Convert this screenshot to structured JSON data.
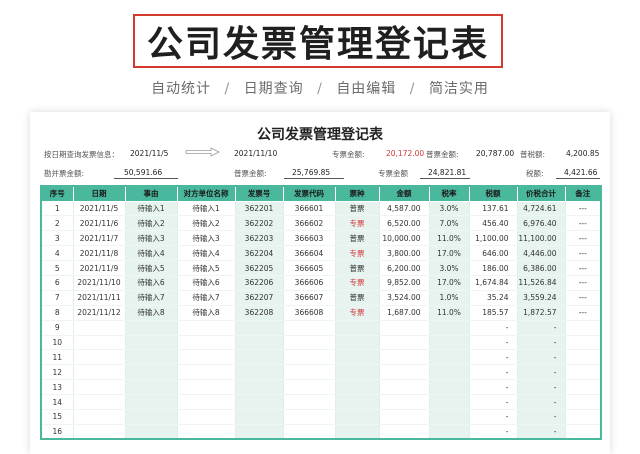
{
  "header": {
    "title": "公司发票管理登记表",
    "subtitle": [
      "自动统计",
      "日期查询",
      "自由编辑",
      "简洁实用"
    ],
    "separator": "/"
  },
  "sheet": {
    "title": "公司发票管理登记表",
    "query_label": "按日期查询发票信息：",
    "date_from": "2021/11/5",
    "date_to": "2021/11/10",
    "special_label": "专票金额:",
    "special_value": "20,172.00",
    "normal_label": "普票金额:",
    "normal_value": "20,787.00",
    "tax_label": "普税额:",
    "tax_value": "4,200.85",
    "cert_label": "勘并票金额:",
    "cert_value": "50,591.66",
    "normal2_label": "普票金额:",
    "normal2_value": "25,769.85",
    "special2_label": "专票金额",
    "special2_value": "24,821.81",
    "tax2_label": "税额:",
    "tax2_value": "4,421.66"
  },
  "table": {
    "headers": [
      "序号",
      "日期",
      "事由",
      "对方单位名称",
      "发票号",
      "发票代码",
      "票种",
      "金额",
      "税率",
      "税额",
      "价税合计",
      "备注"
    ],
    "rows": [
      [
        "1",
        "2021/11/5",
        "待输入1",
        "待输入1",
        "362201",
        "366601",
        "普票",
        "4,587.00",
        "3.0%",
        "137.61",
        "4,724.61",
        "---"
      ],
      [
        "2",
        "2021/11/6",
        "待输入2",
        "待输入2",
        "362202",
        "366602",
        "专票",
        "6,520.00",
        "7.0%",
        "456.40",
        "6,976.40",
        "---"
      ],
      [
        "3",
        "2021/11/7",
        "待输入3",
        "待输入3",
        "362203",
        "366603",
        "普票",
        "10,000.00",
        "11.0%",
        "1,100.00",
        "11,100.00",
        "---"
      ],
      [
        "4",
        "2021/11/8",
        "待输入4",
        "待输入4",
        "362204",
        "366604",
        "专票",
        "3,800.00",
        "17.0%",
        "646.00",
        "4,446.00",
        "---"
      ],
      [
        "5",
        "2021/11/9",
        "待输入5",
        "待输入5",
        "362205",
        "366605",
        "普票",
        "6,200.00",
        "3.0%",
        "186.00",
        "6,386.00",
        "---"
      ],
      [
        "6",
        "2021/11/10",
        "待输入6",
        "待输入6",
        "362206",
        "366606",
        "专票",
        "9,852.00",
        "17.0%",
        "1,674.84",
        "11,526.84",
        "---"
      ],
      [
        "7",
        "2021/11/11",
        "待输入7",
        "待输入7",
        "362207",
        "366607",
        "普票",
        "3,524.00",
        "1.0%",
        "35.24",
        "3,559.24",
        "---"
      ],
      [
        "8",
        "2021/11/12",
        "待输入8",
        "待输入8",
        "362208",
        "366608",
        "专票",
        "1,687.00",
        "11.0%",
        "185.57",
        "1,872.57",
        "---"
      ],
      [
        "9",
        "",
        "",
        "",
        "",
        "",
        "",
        "",
        "",
        "-",
        "-",
        ""
      ],
      [
        "10",
        "",
        "",
        "",
        "",
        "",
        "",
        "",
        "",
        "-",
        "-",
        ""
      ],
      [
        "11",
        "",
        "",
        "",
        "",
        "",
        "",
        "",
        "",
        "-",
        "-",
        ""
      ],
      [
        "12",
        "",
        "",
        "",
        "",
        "",
        "",
        "",
        "",
        "-",
        "-",
        ""
      ],
      [
        "13",
        "",
        "",
        "",
        "",
        "",
        "",
        "",
        "",
        "-",
        "-",
        ""
      ],
      [
        "14",
        "",
        "",
        "",
        "",
        "",
        "",
        "",
        "",
        "-",
        "-",
        ""
      ],
      [
        "15",
        "",
        "",
        "",
        "",
        "",
        "",
        "",
        "",
        "-",
        "-",
        ""
      ],
      [
        "16",
        "",
        "",
        "",
        "",
        "",
        "",
        "",
        "",
        "-",
        "-",
        ""
      ]
    ]
  },
  "colors": {
    "accent": "#4ab89c",
    "highlight": "#d33a2f",
    "shade": "#e6f3ef"
  },
  "icons": {
    "range_arrow": "arrow-right-icon"
  }
}
